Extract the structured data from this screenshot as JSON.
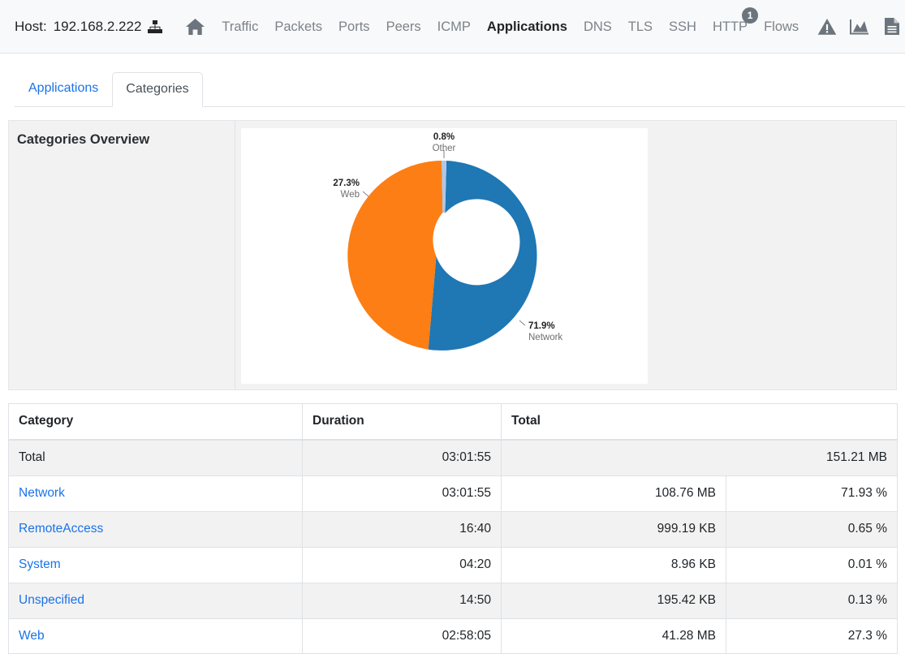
{
  "navbar": {
    "host_prefix": "Host:",
    "host_ip": "192.168.2.222",
    "host_icon": "sitemap-icon",
    "items": [
      {
        "label": "",
        "name": "home-icon",
        "active": false,
        "icon": "home"
      },
      {
        "label": "Traffic",
        "name": "nav-traffic",
        "active": false
      },
      {
        "label": "Packets",
        "name": "nav-packets",
        "active": false
      },
      {
        "label": "Ports",
        "name": "nav-ports",
        "active": false
      },
      {
        "label": "Peers",
        "name": "nav-peers",
        "active": false
      },
      {
        "label": "ICMP",
        "name": "nav-icmp",
        "active": false
      },
      {
        "label": "Applications",
        "name": "nav-applications",
        "active": true
      },
      {
        "label": "DNS",
        "name": "nav-dns",
        "active": false
      },
      {
        "label": "TLS",
        "name": "nav-tls",
        "active": false
      },
      {
        "label": "SSH",
        "name": "nav-ssh",
        "active": false
      },
      {
        "label": "HTTP",
        "name": "nav-http",
        "active": false,
        "badge": "1"
      },
      {
        "label": "Flows",
        "name": "nav-flows",
        "active": false
      }
    ],
    "icons": [
      "alerts-icon",
      "charts-icon",
      "report-icon",
      "settings-icon"
    ],
    "badge_color": "#6c757d"
  },
  "tabs": [
    {
      "label": "Applications",
      "active": false
    },
    {
      "label": "Categories",
      "active": true
    }
  ],
  "panel": {
    "title": "Categories Overview"
  },
  "chart_data": {
    "type": "pie",
    "title": "Categories Overview",
    "donut": true,
    "labels": [
      "Network",
      "Web",
      "Other"
    ],
    "values": [
      71.9,
      27.3,
      0.8
    ],
    "value_labels": [
      "71.9%",
      "27.3%",
      "0.8%"
    ],
    "colors": [
      "#1f77b4",
      "#fd7e14",
      "#aec7e8"
    ],
    "legend": "none",
    "label_position": "outside-with-leader-lines"
  },
  "table": {
    "columns": [
      "Category",
      "Duration",
      "Total",
      ""
    ],
    "total_row": {
      "label": "Total",
      "duration": "03:01:55",
      "total": "151.21 MB"
    },
    "rows": [
      {
        "category": "Network",
        "duration": "03:01:55",
        "total": "108.76 MB",
        "percent": "71.93 %"
      },
      {
        "category": "RemoteAccess",
        "duration": "16:40",
        "total": "999.19 KB",
        "percent": "0.65 %"
      },
      {
        "category": "System",
        "duration": "04:20",
        "total": "8.96 KB",
        "percent": "0.01 %"
      },
      {
        "category": "Unspecified",
        "duration": "14:50",
        "total": "195.42 KB",
        "percent": "0.13 %"
      },
      {
        "category": "Web",
        "duration": "02:58:05",
        "total": "41.28 MB",
        "percent": "27.3 %"
      }
    ]
  },
  "colors": {
    "link": "#1a73e8",
    "navbar_bg": "#f8f9fa",
    "panel_bg": "#f2f2f3",
    "blue": "#1f77b4",
    "orange": "#fd7e14",
    "light_blue": "#aec7e8"
  }
}
